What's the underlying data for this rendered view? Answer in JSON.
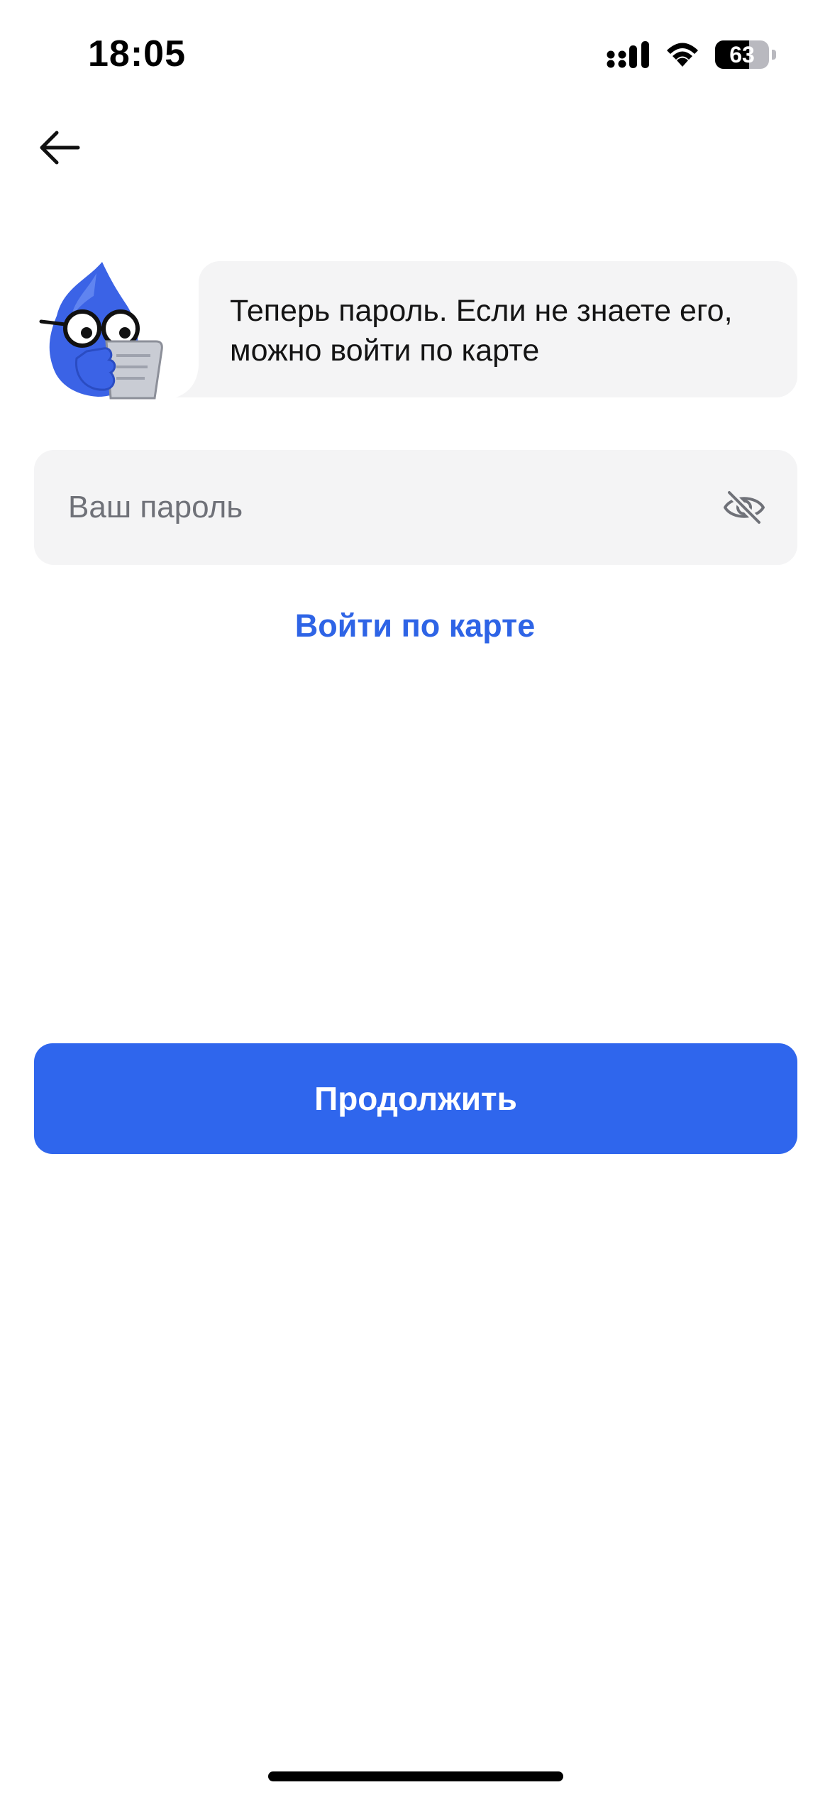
{
  "status_bar": {
    "time": "18:05",
    "battery_level": "63",
    "battery_fraction": 0.63,
    "signal_icon": "cellular-signal-icon",
    "wifi_icon": "wifi-icon",
    "battery_icon": "battery-icon"
  },
  "header": {
    "back_icon": "arrow-left-icon"
  },
  "assistant": {
    "mascot": "mascot-reading-icon",
    "message": "Теперь пароль. Если не знаете его,\nможно войти по карте"
  },
  "password": {
    "placeholder": "Ваш пароль",
    "value": "",
    "visibility_icon": "eye-slash-icon"
  },
  "card_login": {
    "label": "Войти по карте"
  },
  "actions": {
    "continue_label": "Продолжить"
  },
  "colors": {
    "accent": "#2f66ed",
    "link": "#2e64e6",
    "field_bg": "#f4f4f5",
    "placeholder": "#6f7178"
  }
}
